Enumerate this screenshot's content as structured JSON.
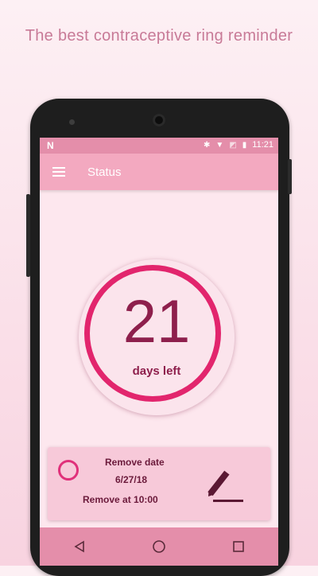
{
  "headline": "The best contraceptive ring reminder",
  "status_bar": {
    "notification_icon": "N",
    "time": "11:21"
  },
  "app_bar": {
    "title": "Status"
  },
  "countdown": {
    "days": "21",
    "label": "days left"
  },
  "removal_card": {
    "title": "Remove date",
    "date": "6/27/18",
    "time_label": "Remove at 10:00"
  },
  "colors": {
    "app_bar": "#f3a9c0",
    "status_bar": "#e48eaa",
    "accent": "#e2256d",
    "text_dark": "#8e1f4c"
  }
}
